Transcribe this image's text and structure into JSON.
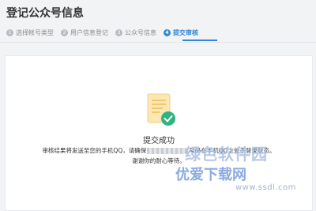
{
  "page": {
    "title": "登记公众号信息"
  },
  "steps": [
    {
      "num": "1",
      "label": "选择帐号类型"
    },
    {
      "num": "2",
      "label": "用户信息登记"
    },
    {
      "num": "3",
      "label": "公众号信息"
    },
    {
      "num": "4",
      "label": "提交审核"
    }
  ],
  "active_step": 4,
  "result": {
    "title": "提交成功",
    "message_part1": "审核结果将发送至您的手机QQ，请确保",
    "message_part2": "号码在手机QQ上处于登录状态。",
    "message_line2": "谢谢你的耐心等待。"
  },
  "watermark": {
    "text1": "绿色软件园",
    "text2": "优爱下载网",
    "url": "www.ssdl.com"
  },
  "colors": {
    "accent": "#2f86d6",
    "success_check": "#2fb380",
    "doc_fill": "#fbe7b4"
  }
}
